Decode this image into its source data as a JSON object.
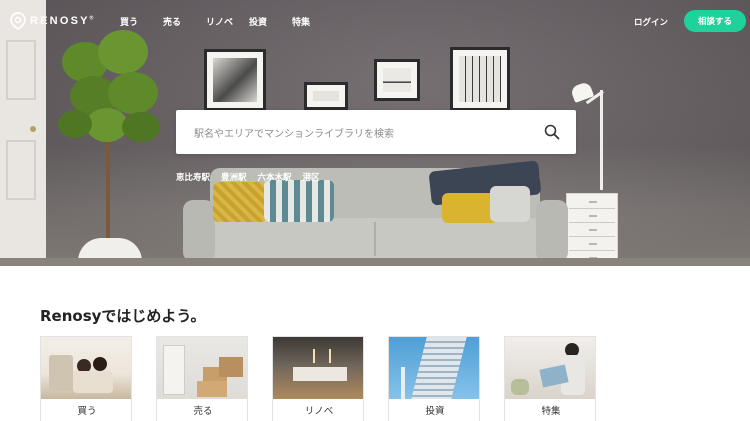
{
  "header": {
    "logo_text": "RENOSY",
    "logo_mark": "®",
    "nav": [
      "買う",
      "売る",
      "リノベ",
      "投資",
      "特集"
    ],
    "login_label": "ログイン",
    "consult_label": "相談する"
  },
  "search": {
    "placeholder": "駅名やエリアでマンションライブラリを検索",
    "icon": "search-icon"
  },
  "stations": [
    "恵比寿駅",
    "豊洲駅",
    "六本木駅",
    "港区"
  ],
  "section": {
    "title": "Renosyではじめよう。",
    "cards": [
      {
        "label": "買う"
      },
      {
        "label": "売る"
      },
      {
        "label": "リノベ"
      },
      {
        "label": "投資"
      },
      {
        "label": "特集"
      }
    ]
  },
  "colors": {
    "accent": "#1fd19a",
    "text_dark": "#222222",
    "white": "#ffffff"
  }
}
